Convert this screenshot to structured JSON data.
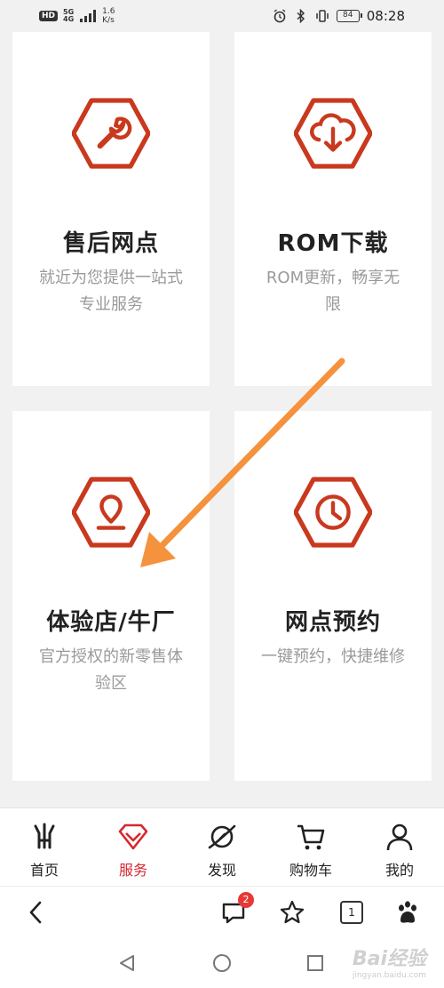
{
  "status_bar": {
    "hd": "HD",
    "network": "5G",
    "network_sub": "4G",
    "speed_value": "1.6",
    "speed_unit": "K/s",
    "battery": "84",
    "time": "08:28"
  },
  "cards": [
    {
      "title": "售后网点",
      "desc": "就近为您提供一站式专业服务",
      "icon": "wrench-icon"
    },
    {
      "title": "ROM下载",
      "desc": "ROM更新，畅享无限",
      "icon": "cloud-download-icon"
    },
    {
      "title": "体验店/牛厂",
      "desc": "官方授权的新零售体验区",
      "icon": "location-pin-icon"
    },
    {
      "title": "网点预约",
      "desc": "一键预约，快捷维修",
      "icon": "clock-icon"
    }
  ],
  "bottom_nav": [
    {
      "label": "首页",
      "icon": "claw-logo-icon"
    },
    {
      "label": "服务",
      "icon": "diamond-icon",
      "active": true
    },
    {
      "label": "发现",
      "icon": "planet-icon"
    },
    {
      "label": "购物车",
      "icon": "cart-icon"
    },
    {
      "label": "我的",
      "icon": "person-icon"
    }
  ],
  "browser_bar": {
    "comments_badge": "2",
    "tab_count": "1"
  },
  "watermark": {
    "text": "Bai经验",
    "sub": "jingyan.baidu.com"
  },
  "colors": {
    "accent": "#d7282f",
    "icon_orange": "#c9391e",
    "arrow": "#f5923e"
  }
}
